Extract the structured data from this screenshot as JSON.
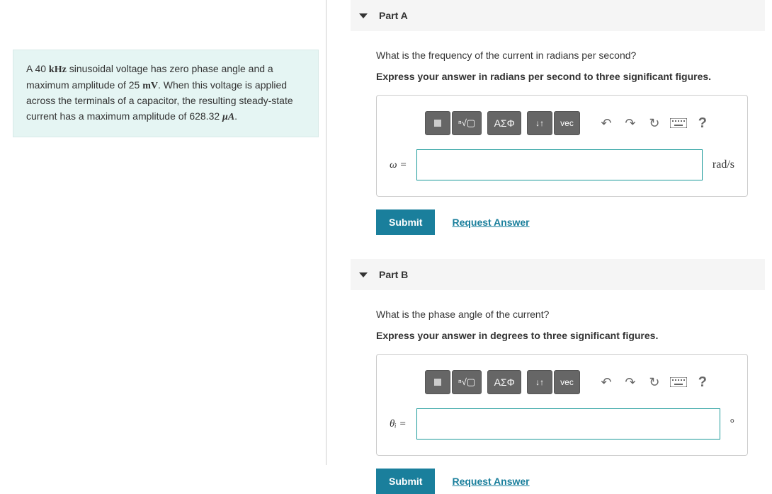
{
  "problem": {
    "text_parts": {
      "p1a": "A 40 ",
      "u1": "kHz",
      "p1b": " sinusoidal voltage has zero phase angle and a maximum amplitude of 25 ",
      "u2": "mV",
      "p1c": ". When this voltage is applied across the terminals of a capacitor, the resulting steady-state current has a maximum amplitude of 628.32 ",
      "u3": "μA",
      "p1d": "."
    }
  },
  "parts": {
    "a": {
      "title": "Part A",
      "question": "What is the frequency of the current in radians per second?",
      "instruction": "Express your answer in radians per second to three significant figures.",
      "var_label": "ω =",
      "unit": "rad/s",
      "input_value": ""
    },
    "b": {
      "title": "Part B",
      "question": "What is the phase angle of the current?",
      "instruction": "Express your answer in degrees to three significant figures.",
      "var_label": "θᵢ =",
      "unit": "°",
      "input_value": ""
    }
  },
  "toolbar": {
    "greek_label": "ΑΣΦ",
    "vec_label": "vec",
    "arrows_label": "↓↑"
  },
  "buttons": {
    "submit": "Submit",
    "request": "Request Answer"
  }
}
